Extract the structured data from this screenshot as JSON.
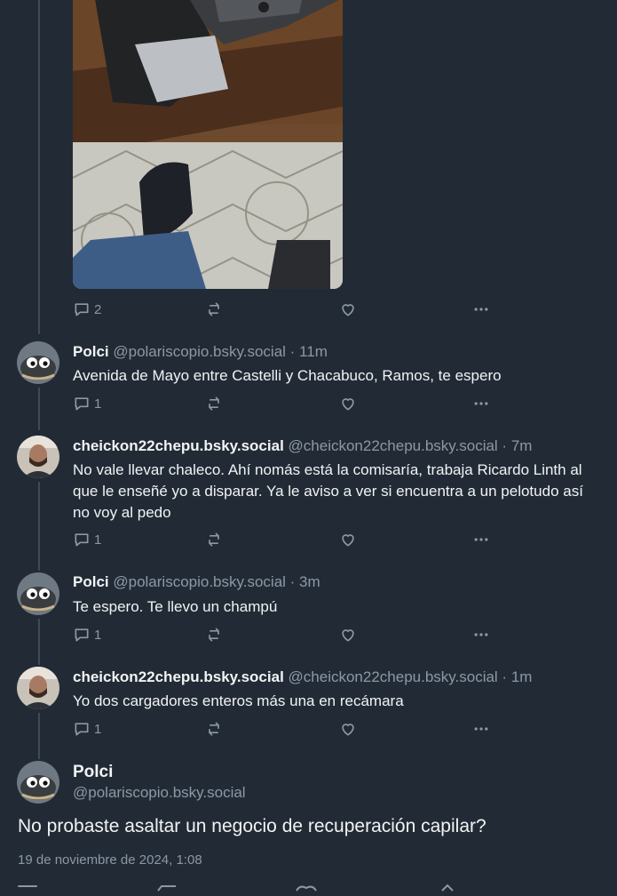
{
  "first_post": {
    "image_alt": "Pistola en una funda sobre un mueble de madera, con un zapato y piso de baldosas",
    "actions": {
      "reply_count": "2"
    }
  },
  "replies": [
    {
      "name": "Polci",
      "handle_time": "@polariscopio.bsky.social · 11m",
      "text": "Avenida de Mayo entre Castelli y Chacabuco, Ramos, te espero",
      "reply_count": "1"
    },
    {
      "name": "cheickon22chepu.bsky.social",
      "handle_time": "@cheickon22chepu.bsky.social · 7m",
      "text": "No vale llevar chaleco. Ahí nomás está la comisaría, trabaja Ricardo Linth al que le enseñé yo a disparar. Ya le aviso a ver si encuentra a un pelotudo así no voy al pedo",
      "reply_count": "1"
    },
    {
      "name": "Polci",
      "handle_time": "@polariscopio.bsky.social · 3m",
      "text": "Te espero. Te llevo un champú",
      "reply_count": "1"
    },
    {
      "name": "cheickon22chepu.bsky.social",
      "handle_time": "@cheickon22chepu.bsky.social · 1m",
      "text": "Yo dos cargadores enteros más una en recámara",
      "reply_count": "1"
    }
  ],
  "main_post": {
    "name": "Polci",
    "handle": "@polariscopio.bsky.social",
    "text": "No probaste asaltar un negocio de recuperación capilar?",
    "date": "19 de noviembre de 2024, 1:08"
  },
  "colors": {
    "background": "#222b35",
    "muted_text": "#8b98a8",
    "thread_line": "#3d4a58"
  }
}
